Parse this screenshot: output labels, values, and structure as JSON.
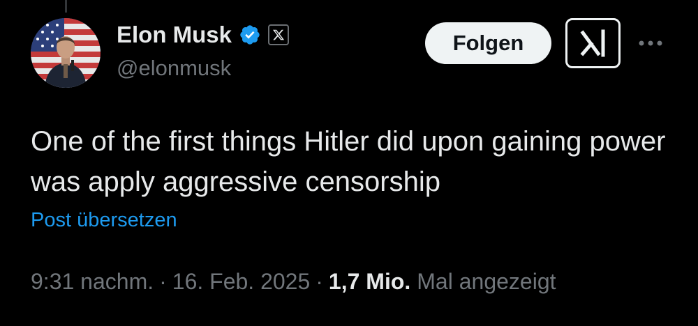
{
  "author": {
    "display_name": "Elon Musk",
    "handle": "@elonmusk",
    "verified": true,
    "verified_color": "#1d9bf0",
    "affiliate_badge": "x-logo-icon",
    "avatar": "avatar-photo-american-flag"
  },
  "actions": {
    "follow_label": "Folgen",
    "grok_icon": "grok-icon",
    "more_icon": "more-dots-icon"
  },
  "tweet": {
    "text": "One of the first things Hitler did upon gaining power was apply aggressive censorship",
    "translate_label": "Post übersetzen"
  },
  "meta": {
    "time": "9:31 nachm.",
    "separator": "·",
    "date": "16. Feb. 2025",
    "views_count": "1,7 Mio.",
    "views_label": "Mal angezeigt"
  },
  "colors": {
    "background": "#000000",
    "text_primary": "#e7e9ea",
    "text_secondary": "#71767b",
    "link": "#1d9bf0",
    "follow_button_bg": "#eff3f4"
  }
}
